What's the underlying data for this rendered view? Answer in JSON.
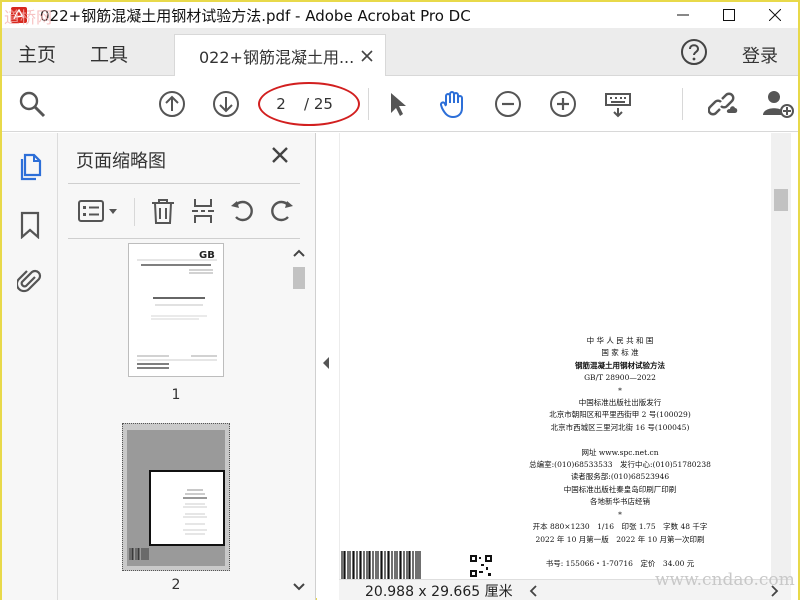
{
  "window": {
    "title": "022+钢筋混凝土用钢材试验方法.pdf - Adobe Acrobat Pro DC"
  },
  "tabs": {
    "home": "主页",
    "tools": "工具",
    "document": "022+钢筋混凝土用...",
    "login": "登录"
  },
  "toolbar": {
    "current_page": "2",
    "total_pages": "/ 25"
  },
  "thumbnails": {
    "title": "页面缩略图",
    "pages": [
      {
        "number": "1"
      },
      {
        "number": "2"
      }
    ]
  },
  "document": {
    "lines": [
      {
        "text": "中 华 人 民 共 和 国",
        "bold": false
      },
      {
        "text": "国 家 标 准",
        "bold": false
      },
      {
        "text": "钢筋混凝土用钢材试验方法",
        "bold": true
      },
      {
        "text": "GB/T 28900—2022",
        "bold": false
      },
      {
        "text": "*",
        "bold": false
      },
      {
        "text": "中国标准出版社出版发行",
        "bold": false
      },
      {
        "text": "北京市朝阳区和平里西街甲 2 号(100029)",
        "bold": false
      },
      {
        "text": "北京市西城区三里河北街 16 号(100045)",
        "bold": false
      },
      {
        "text": "",
        "bold": false
      },
      {
        "text": "网址 www.spc.net.cn",
        "bold": false
      },
      {
        "text": "总编室:(010)68533533　发行中心:(010)51780238",
        "bold": false
      },
      {
        "text": "读者服务部:(010)68523946",
        "bold": false
      },
      {
        "text": "中国标准出版社秦皇岛印刷厂印刷",
        "bold": false
      },
      {
        "text": "各地新华书店经销",
        "bold": false
      },
      {
        "text": "*",
        "bold": false
      },
      {
        "text": "开本 880×1230　1/16　印张 1.75　字数 48 千字",
        "bold": false
      },
      {
        "text": "2022 年 10 月第一版　2022 年 10 月第一次印刷",
        "bold": false
      },
      {
        "text": "",
        "bold": false
      },
      {
        "text": "书号: 155066・1-70716　定价　34.00 元",
        "bold": false
      }
    ]
  },
  "status": {
    "page_size": "20.988 x 29.665 厘米"
  },
  "watermarks": {
    "top": "道桥网",
    "bottom": "www.cndao.com"
  },
  "colors": {
    "accent_blue": "#2d6fd8",
    "icon_gray": "#555555",
    "annotation_red": "#d21f1f"
  }
}
